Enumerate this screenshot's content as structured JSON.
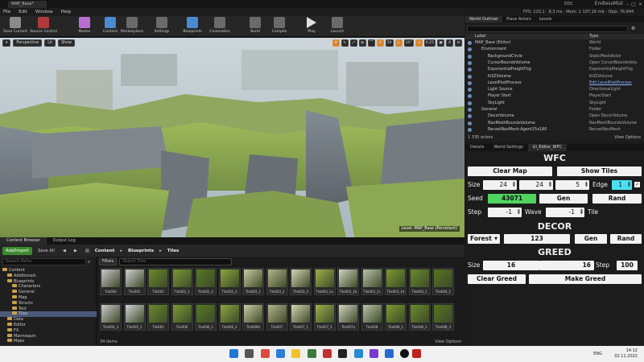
{
  "titlebar": {
    "tab_label": "MAP_Base*",
    "app_name": "EndlessMist",
    "ddc_label": "DDC"
  },
  "menu": [
    "File",
    "Edit",
    "Window",
    "Help"
  ],
  "stats": {
    "fps": "FPS: 120,1",
    "ms": "8,3 ms",
    "mem": "Mem: 1 197,16 mb",
    "objs": "Objs: 76.844"
  },
  "toolbar": [
    {
      "label": "Save Current",
      "icon": "save-icon",
      "color": "#8a8a8a"
    },
    {
      "label": "Source Control",
      "icon": "source-control-icon",
      "color": "#b03a3a"
    },
    {
      "label": "Modes",
      "icon": "modes-icon",
      "color": "#b86fd1"
    },
    {
      "label": "Content",
      "icon": "content-icon",
      "color": "#4a8ad0"
    },
    {
      "label": "Marketplace",
      "icon": "marketplace-icon",
      "color": "#6a6a6a"
    },
    {
      "label": "Settings",
      "icon": "settings-icon",
      "color": "#6a6a6a"
    },
    {
      "label": "Blueprints",
      "icon": "blueprints-icon",
      "color": "#4a8ad0"
    },
    {
      "label": "Cinematics",
      "icon": "cinematics-icon",
      "color": "#6a6a6a"
    },
    {
      "label": "Build",
      "icon": "build-icon",
      "color": "#6a6a6a"
    },
    {
      "label": "Compile",
      "icon": "compile-icon",
      "color": "#6a6a6a"
    },
    {
      "label": "Play",
      "icon": "play-icon",
      "color": "#e0e0e0"
    },
    {
      "label": "Launch",
      "icon": "launch-icon",
      "color": "#6a6a6a"
    }
  ],
  "viewport": {
    "perspective": "Perspective",
    "lit": "Lit",
    "show": "Show",
    "grid_snap": "50",
    "rot_snap": "10°",
    "scale_snap": "0,25",
    "cam_speed": "4",
    "level_label": "Level:  MAP_Base (Persistent)"
  },
  "content_browser": {
    "tabs": [
      "Content Browser",
      "Output Log"
    ],
    "add_import": "Add/Import",
    "save_all": "Save All",
    "crumbs": [
      "Content",
      "Blueprints",
      "Tiles"
    ],
    "search_paths": "Search Paths",
    "filters": "Filters",
    "search_tiles": "Search Tiles",
    "tree": [
      {
        "label": "Content",
        "indent": 0,
        "selected": false
      },
      {
        "label": "Additionals",
        "indent": 1,
        "selected": false
      },
      {
        "label": "Blueprints",
        "indent": 1,
        "selected": false
      },
      {
        "label": "Characters",
        "indent": 2,
        "selected": false
      },
      {
        "label": "General",
        "indent": 2,
        "selected": false
      },
      {
        "label": "Map",
        "indent": 2,
        "selected": false
      },
      {
        "label": "Structs",
        "indent": 2,
        "selected": false
      },
      {
        "label": "Test",
        "indent": 2,
        "selected": false
      },
      {
        "label": "Tiles",
        "indent": 2,
        "selected": true
      },
      {
        "label": "Data",
        "indent": 1,
        "selected": false
      },
      {
        "label": "Editor",
        "indent": 1,
        "selected": false
      },
      {
        "label": "FX",
        "indent": 1,
        "selected": false
      },
      {
        "label": "Mannequin",
        "indent": 1,
        "selected": false
      },
      {
        "label": "Maps",
        "indent": 1,
        "selected": false
      }
    ],
    "assets_row1": [
      "Tile000",
      "Tile001",
      "Tile002",
      "Tile002_1",
      "Tile002_2",
      "Tile002_3",
      "Tile003_1",
      "Tile003_2",
      "Tile003_3",
      "Tile003_1a",
      "Tile003_1b",
      "Tile003_1c",
      "Tile003_1d",
      "Tile004_1",
      "Tile004_2"
    ],
    "assets_row2": [
      "Tile004_3",
      "Tile005_1",
      "Tile005",
      "Tile006",
      "Tile006_1",
      "Tile006_2",
      "Tile006b",
      "Tile007",
      "Tile007_1",
      "Tile007_2",
      "Tile007a",
      "Tile008",
      "Tile008_1",
      "Tile008_2",
      "Tile008_3"
    ],
    "item_count": "34 items",
    "view_options": "View Options"
  },
  "right_tabs": [
    "World Outliner",
    "Place Actors",
    "Levels"
  ],
  "outliner": {
    "col_label": "Label",
    "col_type": "Type",
    "rows": [
      {
        "label": "MAP_Base (Editor)",
        "type": "World",
        "indent": 0,
        "link": false
      },
      {
        "label": "Environment",
        "type": "Folder",
        "indent": 1,
        "link": false
      },
      {
        "label": "BackgroundCircle",
        "type": "StaticMeshActor",
        "indent": 2,
        "link": false
      },
      {
        "label": "CursorBoundsVolume",
        "type": "Open CursorBoundsVolu",
        "indent": 2,
        "link": false
      },
      {
        "label": "ExponentialHeightFog",
        "type": "ExponentialHeightFog",
        "indent": 2,
        "link": false
      },
      {
        "label": "KillZVolume",
        "type": "KillZVolume",
        "indent": 2,
        "link": false
      },
      {
        "label": "LevelPostProcess",
        "type": "Edit LevelPostProcess",
        "indent": 2,
        "link": true
      },
      {
        "label": "Light Source",
        "type": "DirectionalLight",
        "indent": 2,
        "link": false
      },
      {
        "label": "Player Start",
        "type": "PlayerStart",
        "indent": 2,
        "link": false
      },
      {
        "label": "SkyLight",
        "type": "SkyLight",
        "indent": 2,
        "link": false
      },
      {
        "label": "General",
        "type": "Folder",
        "indent": 1,
        "link": false
      },
      {
        "label": "DecorVolume",
        "type": "Open DecorVolume",
        "indent": 2,
        "link": false
      },
      {
        "label": "NavMeshBoundsVolume",
        "type": "NavMeshBoundsVolume",
        "indent": 2,
        "link": false
      },
      {
        "label": "RecastNavMesh-Agent25x180",
        "type": "RecastNavMesh",
        "indent": 2,
        "link": false
      }
    ],
    "actor_count": "1 335 actors",
    "view_options": "View Options"
  },
  "details_tabs": [
    "Details",
    "World Settings",
    "Ui_Editor_WFC"
  ],
  "wfc": {
    "title": "WFC",
    "clear_map": "Clear Map",
    "show_tiles": "Show Tiles",
    "size_label": "Size",
    "size_x": "24",
    "size_y": "24",
    "size_z": "5",
    "edge_label": "Edge",
    "edge_val": "1",
    "seed_label": "Seed",
    "seed_val": "43071",
    "gen": "Gen",
    "rand": "Rand",
    "step_label": "Step",
    "step_val": "-1",
    "wave_label": "Wave",
    "wave_val": "-1",
    "tile_label": "Tile",
    "decor_title": "DECOR",
    "decor_select": "Forest",
    "decor_val": "123",
    "decor_gen": "Gen",
    "decor_rand": "Rand",
    "greed_title": "GREED",
    "greed_size_label": "Size",
    "greed_x": "16",
    "greed_y": "16",
    "greed_step_label": "Step",
    "greed_step": "100",
    "clear_greed": "Clear Greed",
    "make_greed": "Make Greed"
  },
  "taskbar": {
    "lang": "ENG",
    "time": "14:12",
    "date": "02.11.2022"
  }
}
